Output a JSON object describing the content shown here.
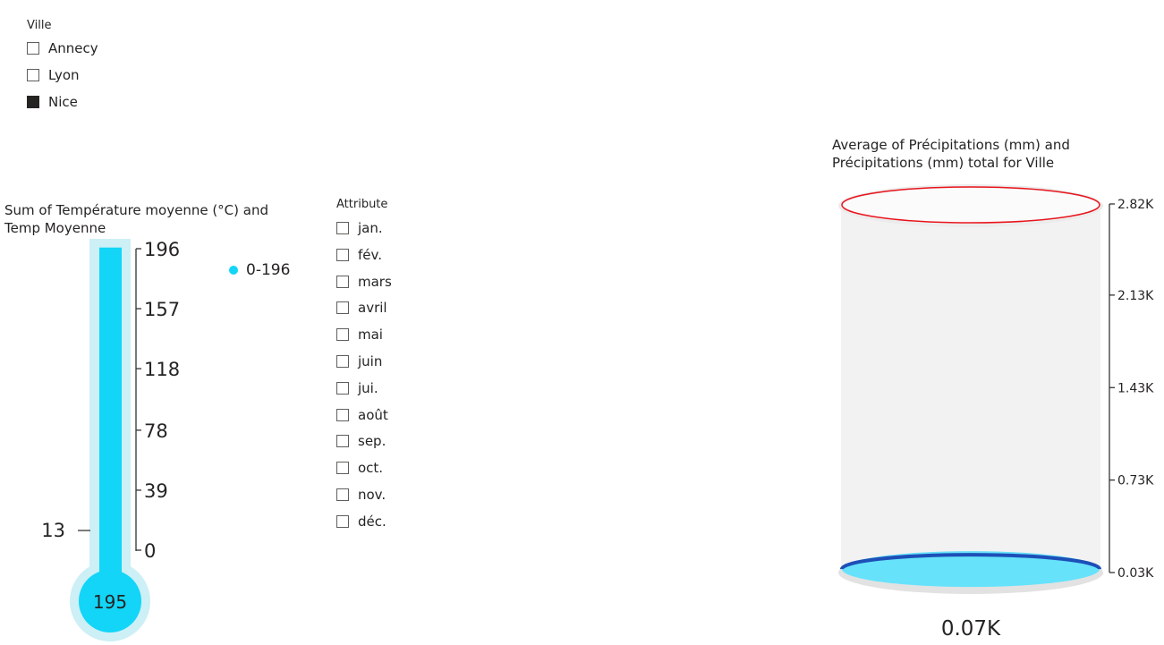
{
  "ville_slicer": {
    "title": "Ville",
    "items": [
      {
        "label": "Annecy",
        "checked": false
      },
      {
        "label": "Lyon",
        "checked": false
      },
      {
        "label": "Nice",
        "checked": true
      }
    ]
  },
  "attribute_slicer": {
    "title": "Attribute",
    "items": [
      {
        "label": "jan.",
        "checked": false
      },
      {
        "label": "fév.",
        "checked": false
      },
      {
        "label": "mars",
        "checked": false
      },
      {
        "label": "avril",
        "checked": false
      },
      {
        "label": "mai",
        "checked": false
      },
      {
        "label": "juin",
        "checked": false
      },
      {
        "label": "jui.",
        "checked": false
      },
      {
        "label": "août",
        "checked": false
      },
      {
        "label": "sep.",
        "checked": false
      },
      {
        "label": "oct.",
        "checked": false
      },
      {
        "label": "nov.",
        "checked": false
      },
      {
        "label": "déc.",
        "checked": false
      }
    ]
  },
  "thermometer": {
    "title_line1": "Sum of Température moyenne (°C) and",
    "title_line2": "Temp Moyenne",
    "value_label": "195",
    "side_marker": "13",
    "legend_label": "0-196",
    "colors": {
      "fill": "#12d5f7",
      "tube": "#cdeff6"
    }
  },
  "cylinder": {
    "title_line1": "Average of Précipitations (mm) and",
    "title_line2": "Précipitations (mm) total for Ville",
    "value_label": "0.07K",
    "colors": {
      "body": "#f2f2f2",
      "liquid": "#66e2fb",
      "liquid_rim": "#1d4fb8",
      "target_rim": "#e8141c"
    }
  },
  "chart_data": [
    {
      "type": "thermometer",
      "title": "Sum of Température moyenne (°C) and Temp Moyenne",
      "value": 195,
      "target": 13,
      "ylim": [
        0,
        196
      ],
      "ticks": [
        0,
        39,
        78,
        118,
        157,
        196
      ],
      "tick_labels": [
        "0",
        "39",
        "78",
        "118",
        "157",
        "196"
      ],
      "legend": [
        "0-196"
      ]
    },
    {
      "type": "cylinder",
      "title": "Average of Précipitations (mm) and Précipitations (mm) total for Ville",
      "value": 70,
      "target": 2820,
      "ylim": [
        30,
        2820
      ],
      "ticks": [
        30,
        730,
        1430,
        2130,
        2820
      ],
      "tick_labels": [
        "0.03K",
        "0.73K",
        "1.43K",
        "2.13K",
        "2.82K"
      ]
    }
  ]
}
